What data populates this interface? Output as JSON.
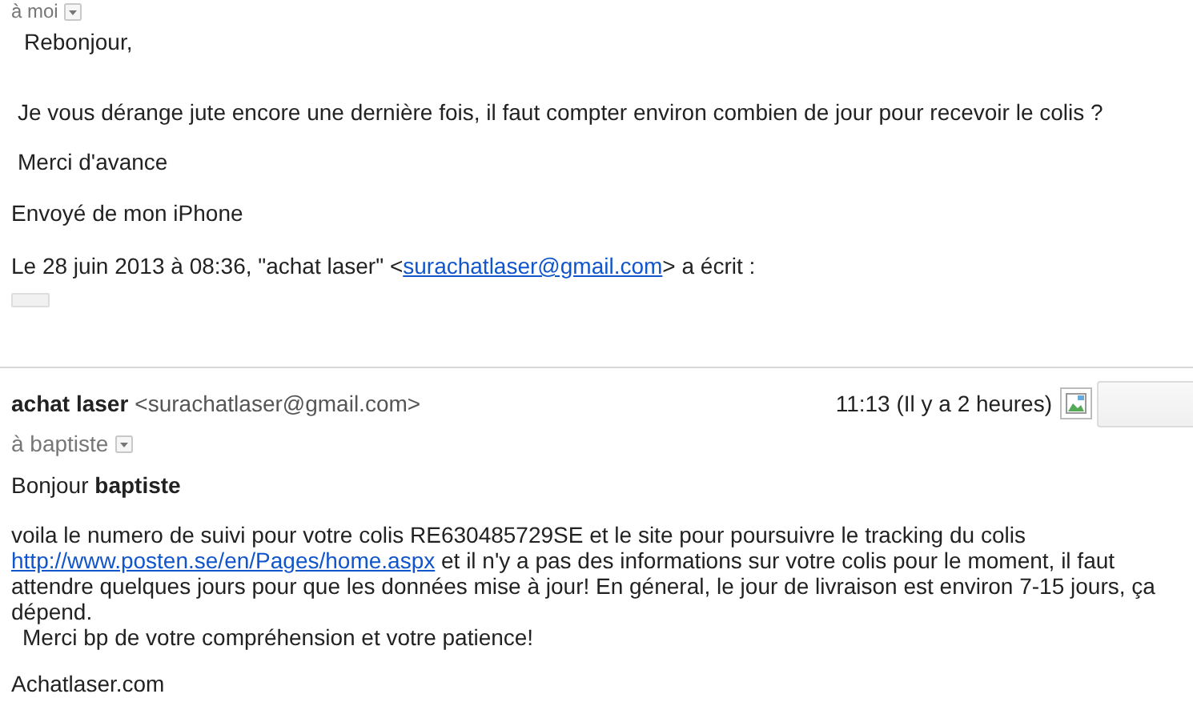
{
  "top_recipient": {
    "label": "à moi"
  },
  "quoted_message": {
    "lines": [
      "Rebonjour,",
      "Je vous dérange jute encore une dernière fois, il faut compter environ combien de jour pour recevoir le colis ?",
      "Merci d'avance",
      "Envoyé de mon iPhone"
    ],
    "attribution": {
      "before": "Le 28 juin 2013 à 08:36, \"achat laser\" <",
      "link": "surachatlaser@gmail.com",
      "after": "> a écrit :"
    }
  },
  "message": {
    "sender_name": "achat laser",
    "sender_email": "<surachatlaser@gmail.com>",
    "time": "11:13 (Il y a 2 heures)",
    "recipient": "à baptiste",
    "greeting": "Bonjour **baptiste**",
    "paragraph": {
      "before": "voila le numero de suivi pour votre colis RE630485729SE et le site pour poursuivre le tracking du colis ",
      "link": "http://www.posten.se/en/Pages/home.aspx",
      "after": " et il n'y a pas des informations sur votre colis pour le moment, il faut attendre quelques jours pour que les données mise à jour! En géneral, le jour de livraison est environ 7-15 jours, ça dépend."
    },
    "thanks": "Merci bp de votre compréhension et votre patience!",
    "signature": "Achatlaser.com"
  }
}
